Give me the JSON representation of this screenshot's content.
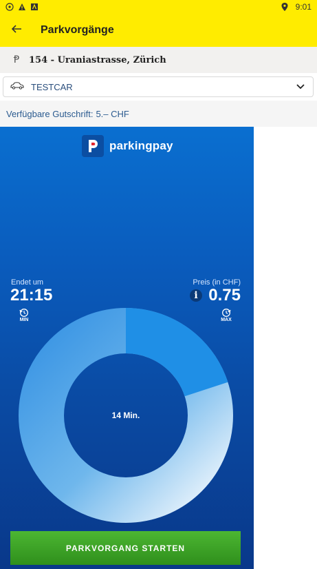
{
  "statusbar": {
    "time": "9:01",
    "icons": [
      "notification-icon",
      "warning-icon",
      "app-icon",
      "location-icon"
    ]
  },
  "appbar": {
    "title": "Parkvorgänge",
    "back_icon": "arrow-left-icon"
  },
  "zone": {
    "icon": "parking-p-icon",
    "text": "154 - Uraniastrasse, Zürich"
  },
  "vehicle": {
    "icon": "car-icon",
    "name": "TESTCAR",
    "dropdown_icon": "chevron-down-icon"
  },
  "credit": {
    "label": "Verfügbare Gutschrift:",
    "value": "5.– CHF"
  },
  "brand": {
    "name": "parkingpay",
    "logo": "parkingpay-logo"
  },
  "timer": {
    "end_label": "Endet um",
    "end_time": "21:15",
    "min_label": "MIN",
    "price_label": "Preis (in CHF)",
    "price": "0.75",
    "max_label": "MAX",
    "duration": "14 Min.",
    "fill_fraction": 0.2
  },
  "action": {
    "start_label": "PARKVORGANG STARTEN"
  },
  "colors": {
    "header": "#ffec00",
    "panel": "#0a5cbd",
    "start_button": "#3da02a"
  }
}
